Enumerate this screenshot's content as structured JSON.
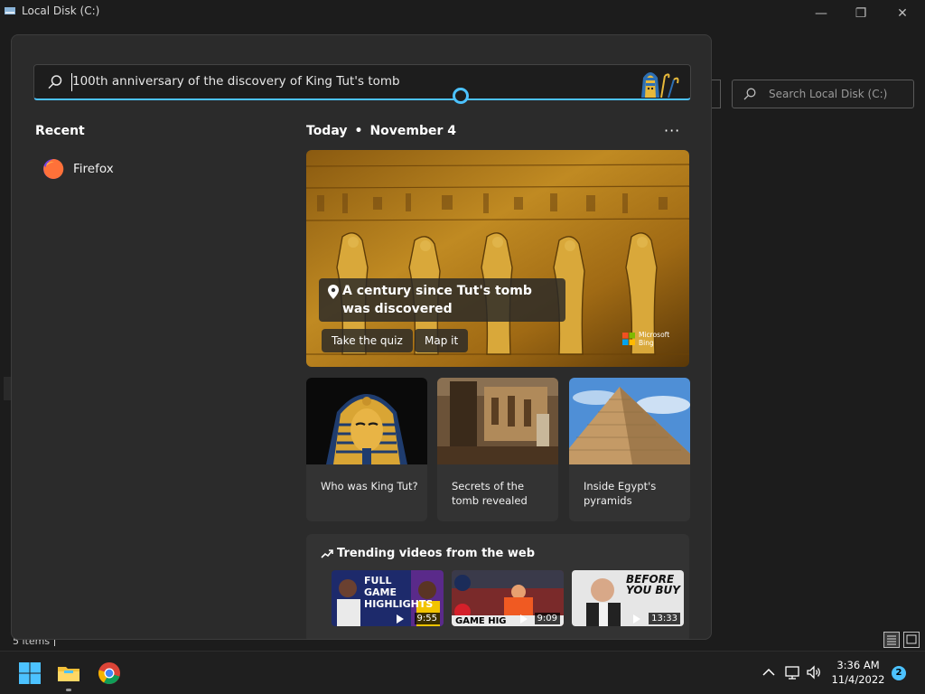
{
  "explorer": {
    "title": "Local Disk (C:)",
    "search_placeholder": "Search Local Disk (C:)",
    "status": "5 items",
    "controls": {
      "minimize": "—",
      "maximize": "❐",
      "close": "✕"
    }
  },
  "search": {
    "query": "100th anniversary of the discovery of King Tut's tomb"
  },
  "recent": {
    "title": "Recent",
    "items": [
      {
        "label": "Firefox",
        "icon": "firefox-icon"
      }
    ]
  },
  "today": {
    "label": "Today",
    "separator": "•",
    "date": "November 4",
    "more": "···"
  },
  "hero": {
    "caption": "A century since Tut's tomb was discovered",
    "buttons": [
      "Take the quiz",
      "Map it"
    ],
    "brand": "Microsoft Bing"
  },
  "cards": [
    {
      "label": "Who was King Tut?",
      "image": "golden-mask"
    },
    {
      "label": "Secrets of the tomb revealed",
      "image": "tomb-interior"
    },
    {
      "label": "Inside Egypt's pyramids",
      "image": "pyramid"
    }
  ],
  "trending": {
    "title": "Trending videos from the web",
    "videos": [
      {
        "duration": "9:55",
        "overlay": "FULL GAME HIGHLIGHTS"
      },
      {
        "duration": "9:09",
        "overlay": "GAME HIG"
      },
      {
        "duration": "13:33",
        "overlay": "BEFORE YOU BUY"
      }
    ]
  },
  "taskbar": {
    "time": "3:36 AM",
    "date": "11/4/2022",
    "notifications": "2"
  },
  "colors": {
    "accent": "#4cc2ff",
    "panel": "#2b2b2b",
    "card": "#333333"
  }
}
